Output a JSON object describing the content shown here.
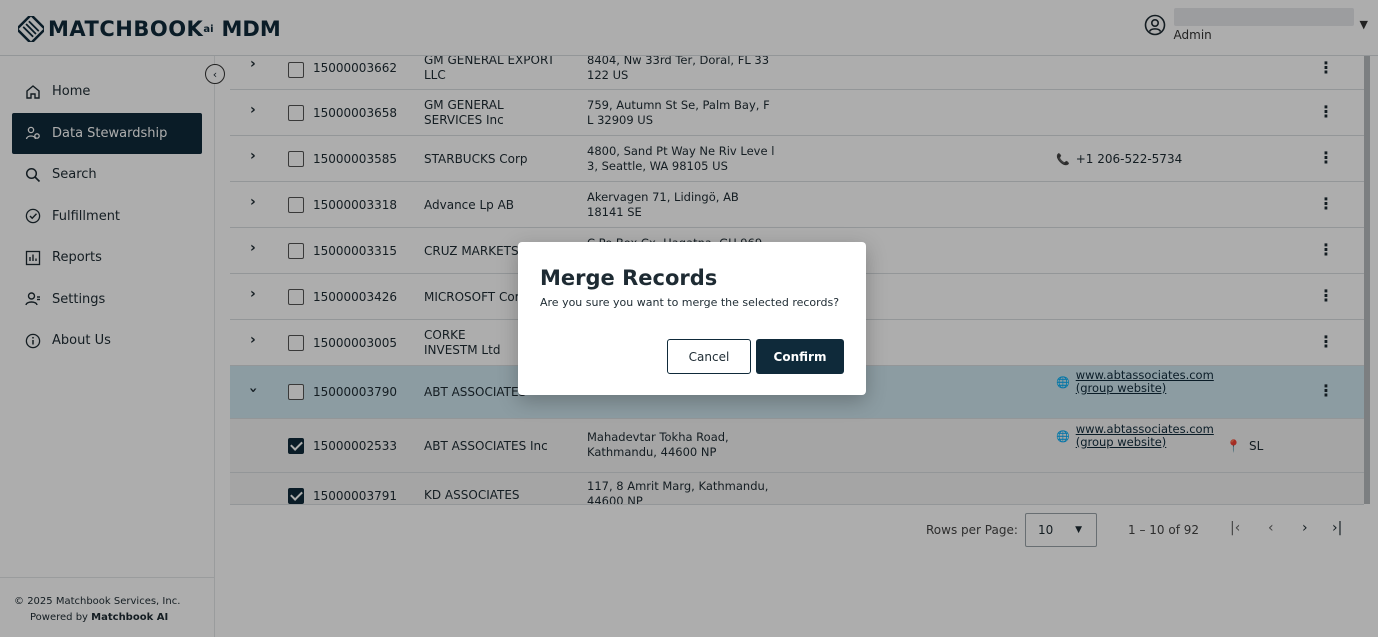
{
  "header": {
    "logo_text": "MATCHBOOK",
    "logo_ai": "ai",
    "product": "MDM",
    "user_role": "Admin"
  },
  "sidebar": {
    "items": [
      {
        "label": "Home",
        "icon": "home-icon"
      },
      {
        "label": "Data Stewardship",
        "icon": "users-icon",
        "active": true
      },
      {
        "label": "Search",
        "icon": "search-icon"
      },
      {
        "label": "Fulfillment",
        "icon": "check-circle-icon"
      },
      {
        "label": "Reports",
        "icon": "bar-chart-icon"
      },
      {
        "label": "Settings",
        "icon": "user-settings-icon"
      },
      {
        "label": "About Us",
        "icon": "info-icon"
      }
    ],
    "footer_copyright": "2025 Matchbook Services, Inc.",
    "footer_powered": "Powered by",
    "footer_brand": "Matchbook AI"
  },
  "table": {
    "rows": [
      {
        "id": "15000003662",
        "name": "GM GENERAL EXPORT LLC",
        "address": "8404, Nw 33rd Ter, Doral, FL 33 122 US"
      },
      {
        "id": "15000003658",
        "name": "GM GENERAL SERVICES Inc",
        "address": "759, Autumn St Se, Palm Bay, F L 32909 US"
      },
      {
        "id": "15000003585",
        "name": "STARBUCKS Corp",
        "address": "4800, Sand Pt Way Ne Riv Leve l 3, Seattle, WA 98105 US",
        "phone": "+1 206-522-5734"
      },
      {
        "id": "15000003318",
        "name": "Advance Lp AB",
        "address": "Akervagen 71, Lidingö, AB 18141 SE"
      },
      {
        "id": "15000003315",
        "name": "CRUZ MARKETS",
        "address": "C Po Box Cx, Hagatna, GU 969"
      },
      {
        "id": "15000003426",
        "name": "MICROSOFT Cor",
        "address": ""
      },
      {
        "id": "15000003005",
        "name": "CORKE INVESTM Ltd",
        "address": ""
      },
      {
        "id": "15000003790",
        "name": "ABT ASSOCIATES",
        "address": "",
        "website": "www.abtassociates.com (group website)"
      },
      {
        "id": "15000002533",
        "name": "ABT ASSOCIATES Inc",
        "address": "Mahadevtar Tokha Road, Kathmandu, 44600 NP",
        "website": "www.abtassociates.com (group website)",
        "location": "SL"
      },
      {
        "id": "15000003791",
        "name": "KD ASSOCIATES",
        "address": "117, 8 Amrit Marg, Kathmandu, 44600 NP"
      }
    ]
  },
  "pager": {
    "rows_label": "Rows per Page:",
    "rows_value": "10",
    "range": "1 – 10 of 92"
  },
  "dialog": {
    "title": "Merge Records",
    "message": "Are you sure you want to merge the selected records?",
    "cancel_label": "Cancel",
    "confirm_label": "Confirm"
  },
  "colors": {
    "primary": "#0f2a3a",
    "expanded_row": "#cfe6ef"
  }
}
